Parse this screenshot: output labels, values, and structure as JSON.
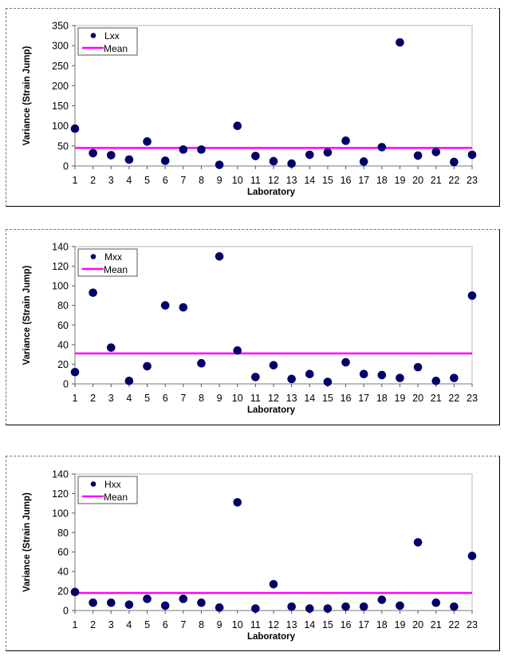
{
  "chart_data": [
    {
      "type": "scatter",
      "xlabel": "Laboratory",
      "ylabel": "Variance (Strain Jump)",
      "x": [
        1,
        2,
        3,
        4,
        5,
        6,
        7,
        8,
        9,
        10,
        11,
        12,
        13,
        14,
        15,
        16,
        17,
        18,
        19,
        20,
        21,
        22,
        23
      ],
      "ylim": [
        0,
        350
      ],
      "yticks": [
        0,
        50,
        100,
        150,
        200,
        250,
        300,
        350
      ],
      "grid": false,
      "legend": "top-left",
      "series": [
        {
          "name": "Lxx",
          "kind": "points",
          "color": "#000066",
          "values": [
            93,
            32,
            27,
            16,
            61,
            13,
            41,
            41,
            3,
            100,
            25,
            12,
            6,
            28,
            34,
            63,
            11,
            47,
            308,
            26,
            35,
            10,
            28
          ]
        },
        {
          "name": "Mean",
          "kind": "hline",
          "color": "#ff00ff",
          "value": 45
        }
      ]
    },
    {
      "type": "scatter",
      "xlabel": "Laboratory",
      "ylabel": "Variance (Strain Jump)",
      "x": [
        1,
        2,
        3,
        4,
        5,
        6,
        7,
        8,
        9,
        10,
        11,
        12,
        13,
        14,
        15,
        16,
        17,
        18,
        19,
        20,
        21,
        22,
        23
      ],
      "ylim": [
        0,
        140
      ],
      "yticks": [
        0,
        20,
        40,
        60,
        80,
        100,
        120,
        140
      ],
      "grid": false,
      "legend": "top-left",
      "series": [
        {
          "name": "Mxx",
          "kind": "points",
          "color": "#000066",
          "values": [
            12,
            93,
            37,
            3,
            18,
            80,
            78,
            21,
            130,
            34,
            7,
            19,
            5,
            10,
            2,
            22,
            10,
            9,
            6,
            17,
            3,
            6,
            90
          ]
        },
        {
          "name": "Mean",
          "kind": "hline",
          "color": "#ff00ff",
          "value": 31
        }
      ]
    },
    {
      "type": "scatter",
      "xlabel": "Laboratory",
      "ylabel": "Variance (Strain Jump)",
      "x": [
        1,
        2,
        3,
        4,
        5,
        6,
        7,
        8,
        9,
        10,
        11,
        12,
        13,
        14,
        15,
        16,
        17,
        18,
        19,
        20,
        21,
        22,
        23
      ],
      "ylim": [
        0,
        140
      ],
      "yticks": [
        0,
        20,
        40,
        60,
        80,
        100,
        120,
        140
      ],
      "grid": false,
      "legend": "top-left",
      "series": [
        {
          "name": "Hxx",
          "kind": "points",
          "color": "#000066",
          "values": [
            19,
            8,
            8,
            6,
            12,
            5,
            12,
            8,
            3,
            111,
            2,
            27,
            4,
            2,
            2,
            4,
            4,
            11,
            5,
            70,
            8,
            4,
            56
          ]
        },
        {
          "name": "Mean",
          "kind": "hline",
          "color": "#ff00ff",
          "value": 18
        }
      ]
    }
  ]
}
